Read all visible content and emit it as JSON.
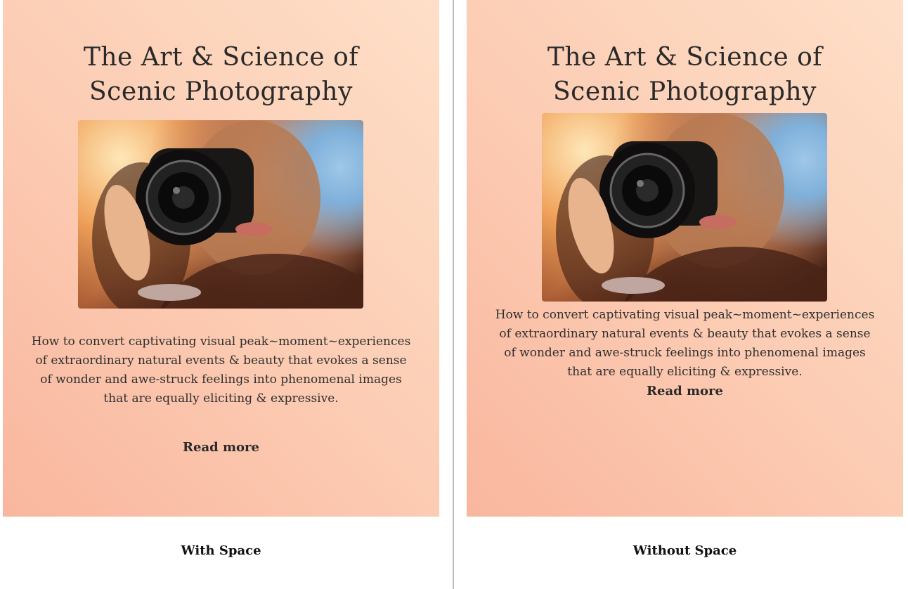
{
  "panels": [
    {
      "title_lines": [
        "The Art & Science of",
        "Scenic Photography"
      ],
      "description_lines": [
        "How to convert captivating visual peak~moment~experiences",
        "of extraordinary natural events & beauty that evokes a sense",
        "of wonder and awe-struck feelings into phenomenal images",
        "that are equally eliciting & expressive."
      ],
      "read_more": "Read more",
      "caption": "With Space"
    },
    {
      "title_lines": [
        "The Art & Science of",
        "Scenic Photography"
      ],
      "description_lines": [
        "How to convert captivating visual peak~moment~experiences",
        "of extraordinary natural events & beauty that evokes a sense",
        "of wonder and awe-struck feelings into phenomenal images",
        "that are equally eliciting & expressive."
      ],
      "read_more": "Read more",
      "caption": "Without Space"
    }
  ],
  "colors": {
    "gradient_start": "#f9b69e",
    "gradient_end": "#fedfc8",
    "text": "#2a2a2a"
  }
}
